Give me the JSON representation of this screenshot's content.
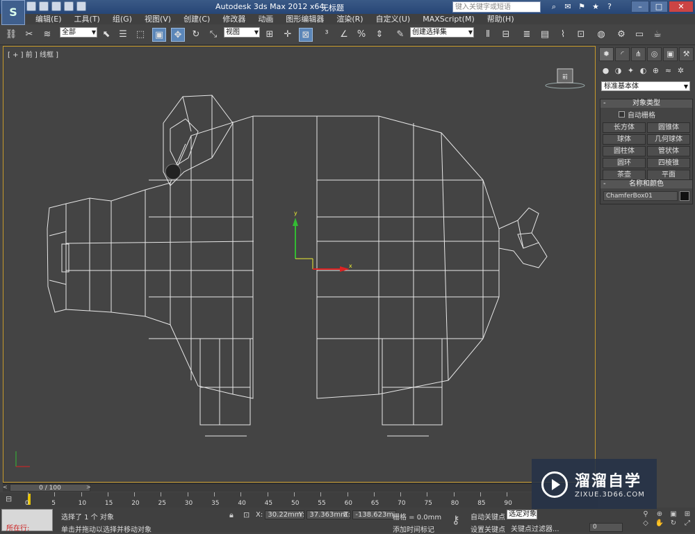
{
  "title_bar": {
    "app_title": "Autodesk 3ds Max  2012 x64",
    "doc_title": "无标题",
    "search_placeholder": "键入关键字或短语"
  },
  "menu": [
    "编辑(E)",
    "工具(T)",
    "组(G)",
    "视图(V)",
    "创建(C)",
    "修改器",
    "动画",
    "图形编辑器",
    "渲染(R)",
    "自定义(U)",
    "MAXScript(M)",
    "帮助(H)"
  ],
  "toolbar": {
    "selection_filter": "全部",
    "reference_coord": "视图",
    "named_selection": "创建选择集"
  },
  "viewport": {
    "label": "[ + ] 前 ] 线框 ]",
    "viewcube_label": "前"
  },
  "command_panel": {
    "category_dropdown": "标准基本体",
    "object_type": {
      "title": "对象类型",
      "autogrid_label": "自动栅格",
      "buttons": [
        "长方体",
        "圆锥体",
        "球体",
        "几何球体",
        "圆柱体",
        "管状体",
        "圆环",
        "四棱锥",
        "茶壶",
        "平面"
      ]
    },
    "name_color": {
      "title": "名称和颜色",
      "object_name": "ChamferBox01",
      "color": "#111111"
    }
  },
  "time_slider": {
    "position": "0 / 100"
  },
  "track_bar": {
    "ticks": [
      "0",
      "5",
      "10",
      "15",
      "20",
      "25",
      "30",
      "35",
      "40",
      "45",
      "50",
      "55",
      "60",
      "65",
      "70",
      "75",
      "80",
      "85",
      "90"
    ]
  },
  "status_bar": {
    "maxscript_label": "所在行:",
    "selection_status": "选择了 1 个 对象",
    "prompt": "单击并拖动以选择并移动对象",
    "x_label": "X:",
    "x_value": "30.22mm",
    "y_label": "Y:",
    "y_value": "37.363mm",
    "z_label": "Z:",
    "z_value": "-138.623m",
    "grid": "栅格 = 0.0mm",
    "add_time_tag": "添加时间标记",
    "auto_key": "自动关键点",
    "set_key": "设置关键点",
    "selected_dropdown": "选定对象",
    "key_filters": "关键点过滤器...",
    "current_frame": "0"
  },
  "watermark": {
    "brand_cn": "溜溜自学",
    "brand_url": "ZIXUE.3D66.COM"
  }
}
